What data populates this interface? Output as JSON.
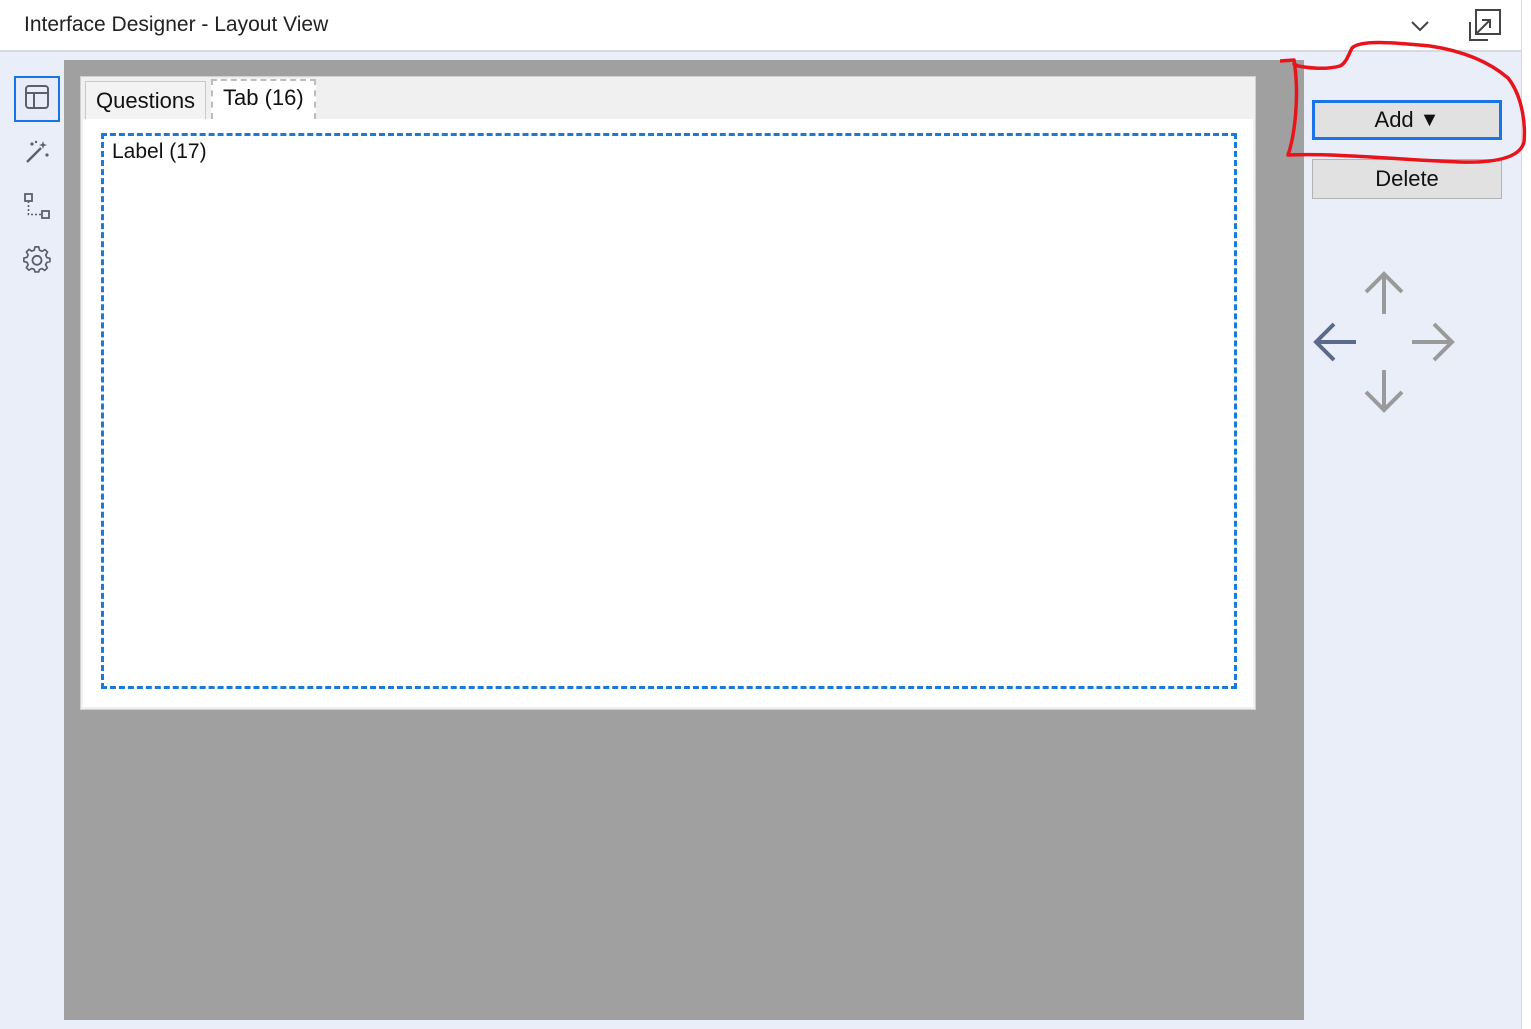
{
  "window": {
    "title": "Interface Designer - Layout View",
    "collapse_icon": "chevron-down-icon",
    "popout_icon": "pop-out-icon"
  },
  "sidebar": {
    "items": [
      {
        "icon": "layout-icon",
        "active": true
      },
      {
        "icon": "magic-wand-icon",
        "active": false
      },
      {
        "icon": "tree-view-icon",
        "active": false
      },
      {
        "icon": "gear-icon",
        "active": false
      }
    ]
  },
  "tabs": [
    {
      "label": "Questions",
      "active": false
    },
    {
      "label": "Tab (16)",
      "active": true
    }
  ],
  "selected_label": "Label (17)",
  "actions": {
    "add_label": "Add",
    "add_caret": "▼",
    "delete_label": "Delete"
  },
  "nav_arrows": [
    "arrow-up-icon",
    "arrow-left-icon",
    "arrow-right-icon",
    "arrow-down-icon"
  ],
  "colors": {
    "accent": "#1a73e8",
    "annotation": "#e8141c",
    "canvas": "#a0a0a0",
    "sidebar_bg": "#eaeef9"
  }
}
